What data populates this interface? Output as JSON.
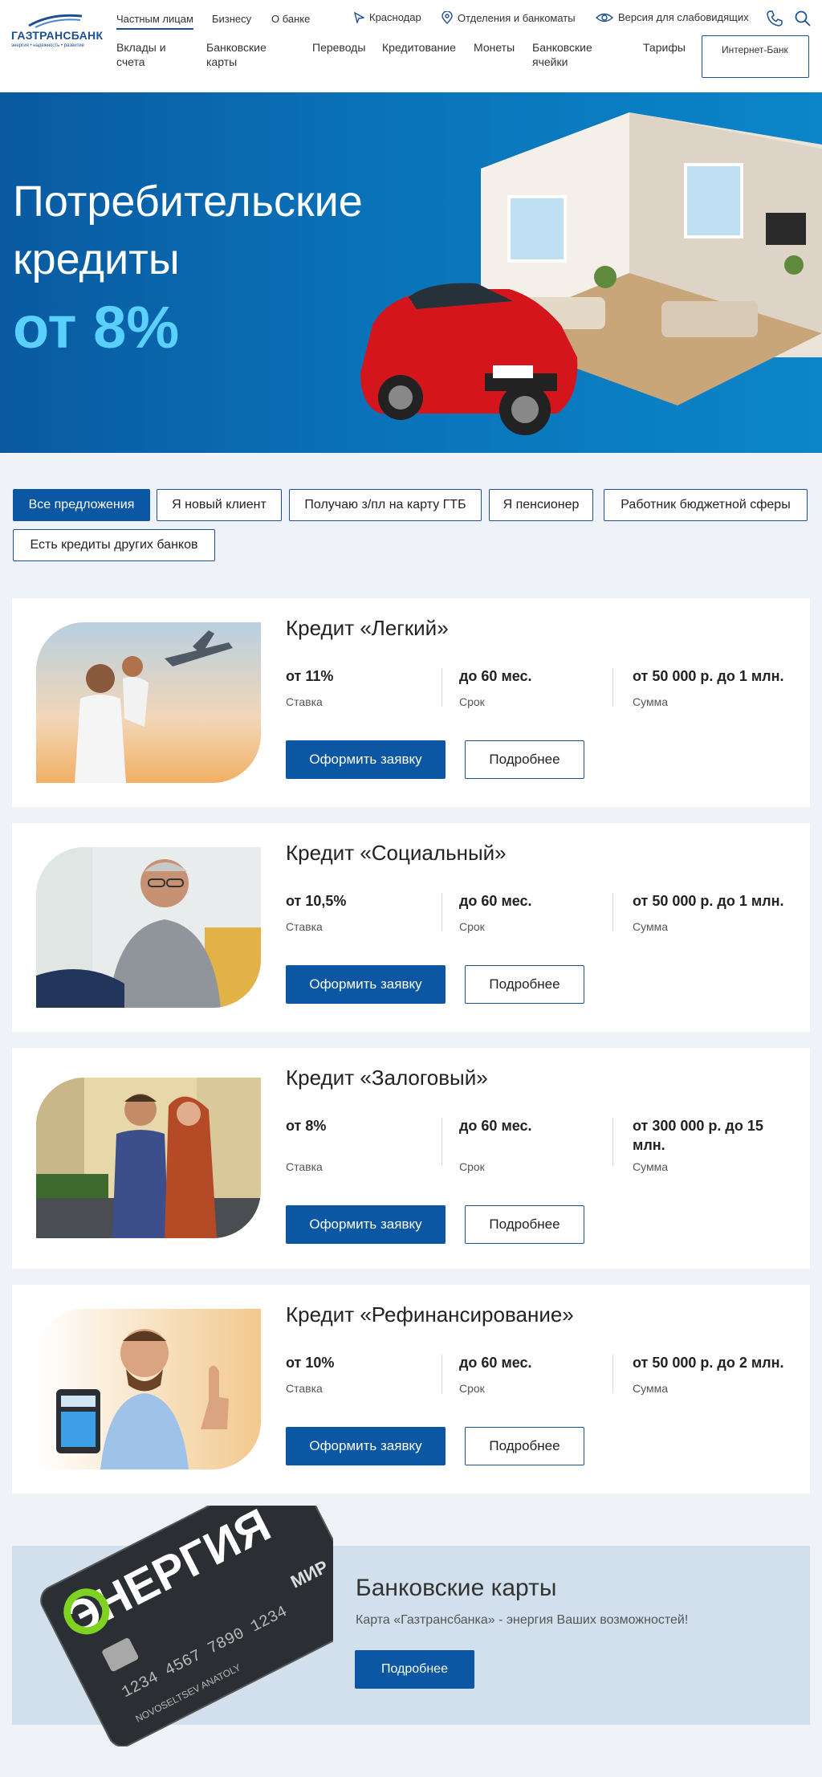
{
  "brand": {
    "name": "ГАЗТРАНСБАНК",
    "tagline": "энергия • надежность • развитие",
    "color": "#1c4f93"
  },
  "segments": [
    {
      "label": "Частным лицам",
      "active": true
    },
    {
      "label": "Бизнесу",
      "active": false
    },
    {
      "label": "О банке",
      "active": false
    }
  ],
  "utility": {
    "city": "Краснодар",
    "branches": "Отделения и банкоматы",
    "accessibility": "Версия для слабовидящих"
  },
  "nav": [
    "Вклады и счета",
    "Банковские карты",
    "Переводы",
    "Кредитование",
    "Монеты",
    "Банковские ячейки",
    "Тарифы"
  ],
  "internet_bank": "Интернет-Банк",
  "hero": {
    "title": "Потребительские кредиты",
    "rate": "от 8%"
  },
  "filters": [
    {
      "label": "Все предложения",
      "active": true
    },
    {
      "label": "Я новый клиент",
      "active": false
    },
    {
      "label": "Получаю з/пл на карту ГТБ",
      "active": false
    },
    {
      "label": "Я пенсионер",
      "active": false
    },
    {
      "label": "Работник бюджетной сферы",
      "active": false
    },
    {
      "label": "Есть кредиты других банков",
      "active": false
    }
  ],
  "labels": {
    "rate": "Ставка",
    "term": "Срок",
    "amount": "Сумма",
    "apply": "Оформить заявку",
    "more": "Подробнее"
  },
  "products": [
    {
      "title": "Кредит «Легкий»",
      "rate": "от 11%",
      "term": "до 60 мес.",
      "amount": "от 50 000 р. до 1 млн."
    },
    {
      "title": "Кредит «Социальный»",
      "rate": "от 10,5%",
      "term": "до 60 мес.",
      "amount": "от 50 000 р. до 1 млн."
    },
    {
      "title": "Кредит «Залоговый»",
      "rate": "от 8%",
      "term": "до 60 мес.",
      "amount": "от 300 000 р. до 15 млн."
    },
    {
      "title": "Кредит «Рефинансирование»",
      "rate": "от 10%",
      "term": "до 60 мес.",
      "amount": "от 50 000 р. до 2 млн."
    }
  ],
  "cards_banner": {
    "title": "Банковские карты",
    "subtitle": "Карта «Газтрансбанка» - энергия Ваших возможностей!",
    "button": "Подробнее",
    "card_brand": "ЭНЕРГИЯ",
    "card_number": "1234 4567 7890 1234",
    "card_holder": "NOVOSELTSEV ANATOLY",
    "card_network": "МИР"
  }
}
